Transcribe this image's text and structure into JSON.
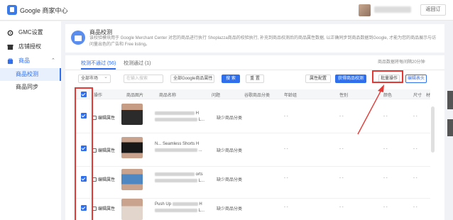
{
  "app": {
    "title": "Google 商家中心",
    "back_label": "返回订"
  },
  "sidebar": {
    "items": [
      {
        "label": "GMC设置",
        "icon": "gear-icon"
      },
      {
        "label": "店铺授权",
        "icon": "shop-icon"
      },
      {
        "label": "商品",
        "icon": "product-icon"
      },
      {
        "label": "商品校测"
      },
      {
        "label": "商品同步"
      }
    ]
  },
  "header": {
    "title": "商品校测",
    "description": "该校验模块用于 Google Merchant Center 对您的商品进行执行 Shoplazza商品的校验执行, 补充到商品校测后的商品属性数据, 以正确同步到商品数据到Google, 才能为您的商品展示与访问量出色的广告和 Free listing。"
  },
  "tabs": [
    {
      "label": "校测不通过 (56)",
      "active": true
    },
    {
      "label": "校测通过 (1)",
      "active": false
    }
  ],
  "sync_time": "商品数据将每间隔20分钟",
  "filters": {
    "market_select": "全部市场",
    "search_placeholder": "在输入搜索",
    "category_select": "全部Google商品属性",
    "search_button": "搜 索",
    "reset_button": "重 置",
    "attribute_config_button": "属性配置",
    "update_check_button": "获得商品校测",
    "bulk_edit_button": "批量操作",
    "export_button": "编辑表头"
  },
  "table": {
    "columns": [
      "操作",
      "商品图片",
      "商品名称",
      "问题",
      "谷歌商品分类",
      "年龄组",
      "性别",
      "颜色",
      "尺寸",
      "材"
    ],
    "rows": [
      {
        "action": "编辑属性",
        "name_suffix": "H",
        "name_line2": "L...",
        "issue": "缺少商品分类",
        "dash": "- -",
        "thumb_colors": [
          "#2b2b2b",
          "#c79c84"
        ]
      },
      {
        "action": "编辑属性",
        "name_prefix": "N... Seamless Shorts",
        "name_suffix": "H",
        "name_line2": "...",
        "issue": "缺少商品分类",
        "dash": "- -",
        "thumb_colors": [
          "#181818",
          "#c9a38d"
        ]
      },
      {
        "action": "编辑属性",
        "name_suffix": "orts",
        "name_line2": "L...",
        "issue": "缺少商品分类",
        "dash": "- -",
        "thumb_colors": [
          "#4f87c2",
          "#c9a38d"
        ]
      },
      {
        "action": "编辑属性",
        "name_prefix": "Push Up",
        "name_suffix": "H",
        "name_line2": "L...",
        "issue": "缺少商品分类",
        "dash": "- -",
        "thumb_colors": [
          "#e2d6cc",
          "#c9a38d"
        ]
      }
    ]
  },
  "colors": {
    "accent": "#2f6fed",
    "highlight": "#e53935"
  }
}
